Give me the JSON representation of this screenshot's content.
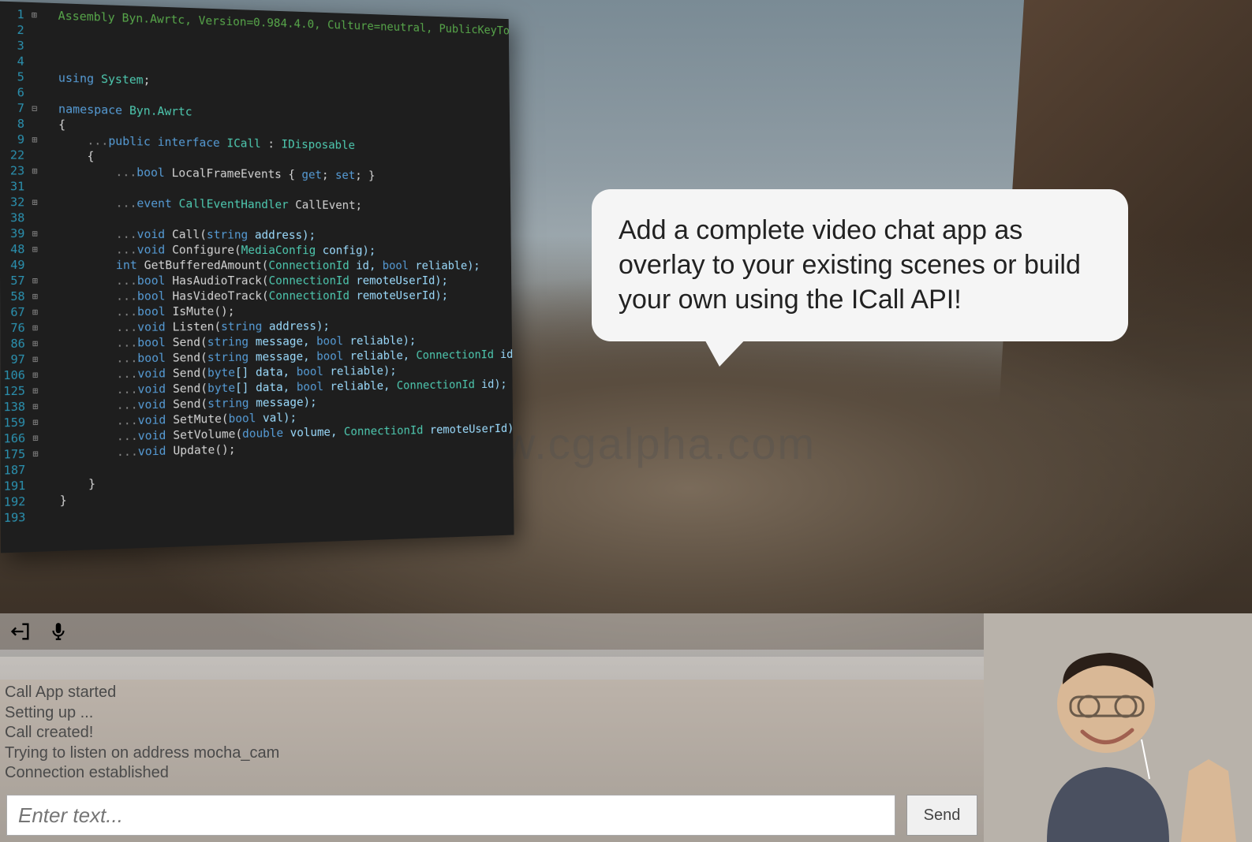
{
  "watermark": "www.cgalpha.com",
  "speech_bubble": "Add a complete video chat app as overlay to your existing scenes or build your own using the ICall API!",
  "editor": {
    "line_numbers": [
      "1",
      "2",
      "3",
      "4",
      "5",
      "6",
      "7",
      "8",
      "9",
      "22",
      "23",
      "31",
      "32",
      "38",
      "39",
      "48",
      "49",
      "57",
      "58",
      "67",
      "76",
      "86",
      "97",
      "106",
      "125",
      "138",
      "159",
      "166",
      "175",
      "187",
      "191",
      "192",
      "193"
    ],
    "lines": {
      "l0": "Assembly Byn.Awrtc, Version=0.984.4.0, Culture=neutral, PublicKeyToken=null",
      "l4_using": "using",
      "l4_system": "System",
      "l6_ns": "namespace",
      "l6_name": "Byn.Awrtc",
      "l8_brace": "{",
      "l9_ellipsis": "...",
      "l9_public": "public interface",
      "l9_icall": "ICall",
      "l9_idis": "IDisposable",
      "l22_brace": "{",
      "l23_bool": "bool",
      "l23_local": "LocalFrameEvents { ",
      "l23_get": "get",
      "l23_set": "set",
      "l31_event": "event",
      "l31_handler": "CallEventHandler",
      "l31_name": "CallEvent;",
      "l38_void": "void",
      "l38_call": "Call(",
      "l38_string": "string",
      "l38_addr": "address);",
      "l39_void": "void",
      "l39_cfg": "Configure(",
      "l39_mc": "MediaConfig",
      "l39_p": "config);",
      "l48_int": "int",
      "l48_gba": "GetBufferedAmount(",
      "l48_cid": "ConnectionId",
      "l48_p": "id, ",
      "l48_bool": "bool",
      "l48_rel": "reliable);",
      "l49_bool": "bool",
      "l49_hat": "HasAudioTrack(",
      "l49_cid": "ConnectionId",
      "l49_p": "remoteUserId);",
      "l57_bool": "bool",
      "l57_hvt": "HasVideoTrack(",
      "l57_cid": "ConnectionId",
      "l57_p": "remoteUserId);",
      "l58_bool": "bool",
      "l58_im": "IsMute();",
      "l67_void": "void",
      "l67_lis": "Listen(",
      "l67_str": "string",
      "l67_p": "address);",
      "l76_bool": "bool",
      "l76_send": "Send(",
      "l76_str": "string",
      "l76_msg": "message, ",
      "l76_b": "bool",
      "l76_rel": "reliable);",
      "l86_bool": "bool",
      "l86_send": "Send(",
      "l86_str": "string",
      "l86_msg": "message, ",
      "l86_b": "bool",
      "l86_rel": "reliable, ",
      "l86_cid": "ConnectionId",
      "l86_id": "id);",
      "l97_void": "void",
      "l97_send": "Send(",
      "l97_byte": "byte",
      "l97_arr": "[] data, ",
      "l97_b": "bool",
      "l97_rel": "reliable);",
      "l106_void": "void",
      "l106_send": "Send(",
      "l106_byte": "byte",
      "l106_arr": "[] data, ",
      "l106_b": "bool",
      "l106_rel": "reliable, ",
      "l106_cid": "ConnectionId",
      "l106_id": "id);",
      "l125_void": "void",
      "l125_send": "Send(",
      "l125_str": "string",
      "l125_msg": "message);",
      "l138_void": "void",
      "l138_sm": "SetMute(",
      "l138_b": "bool",
      "l138_p": "val);",
      "l159_void": "void",
      "l159_sv": "SetVolume(",
      "l159_d": "double",
      "l159_vol": "volume, ",
      "l159_cid": "ConnectionId",
      "l159_p": "remoteUserId);",
      "l166_void": "void",
      "l166_upd": "Update();",
      "l191_brace": "}",
      "l192_brace": "}"
    }
  },
  "chat": {
    "log": [
      "Call App started",
      "Setting up ...",
      "Call created!",
      "Trying to listen on address mocha_cam",
      "Connection established"
    ],
    "input_placeholder": "Enter text...",
    "send_label": "Send"
  }
}
